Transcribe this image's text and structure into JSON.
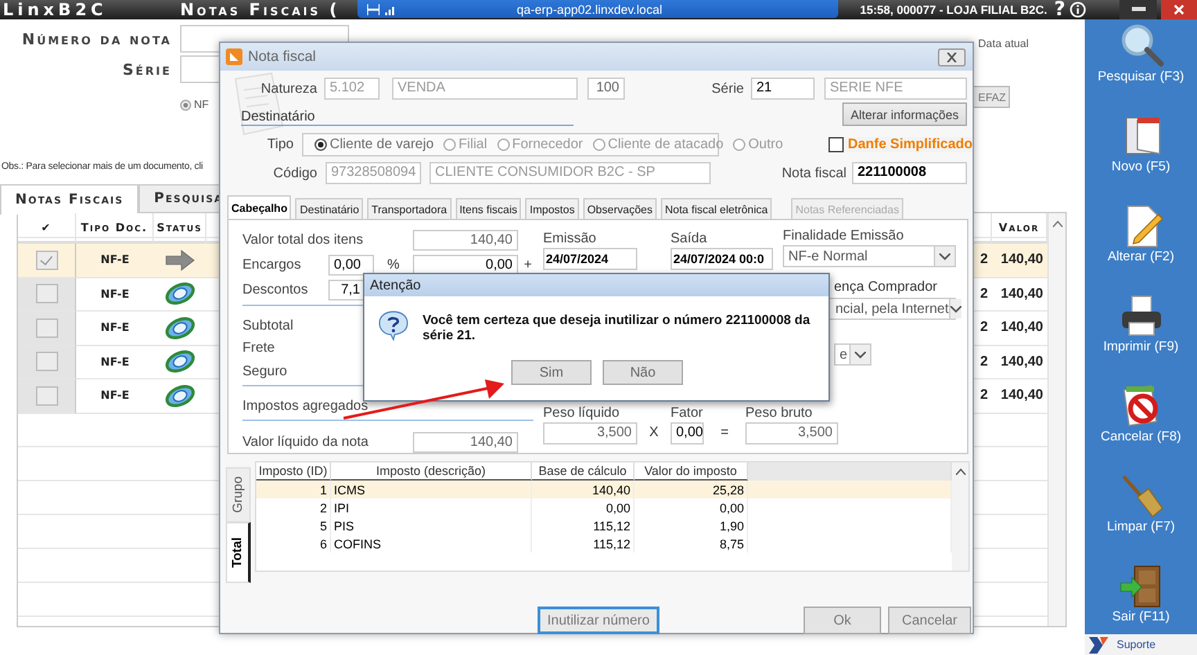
{
  "remote_bar": {
    "host": "qa-erp-app02.linxdev.local"
  },
  "app": {
    "logo": "LinxB2C",
    "title": "Notas Fiscais (",
    "session": "15:58, 000077 - LOJA FILIAL B2C.",
    "help": "?"
  },
  "search_form": {
    "numero_label": "Número da nota",
    "serie_label": "Série",
    "doc_type": {
      "label": "NF",
      "selected": true
    },
    "data_atual_label": "Data atual",
    "button": "EFAZ",
    "obs": "Obs.: Para selecionar mais de um documento, cli"
  },
  "tabs": [
    {
      "label": "Notas Fiscais",
      "selected": true
    },
    {
      "label": "Pesquisa",
      "selected": false
    }
  ],
  "grid": {
    "columns": [
      "✔",
      "Tipo Doc.",
      "Status",
      "Valor"
    ],
    "rows": [
      {
        "selected": true,
        "checked": true,
        "type": "NF-E",
        "kind": "arrow",
        "column_5": "2",
        "value": "140,40"
      },
      {
        "selected": false,
        "checked": false,
        "type": "NF-E",
        "kind": "globe",
        "column_5": "2",
        "value": "140,40"
      },
      {
        "selected": false,
        "checked": false,
        "type": "NF-E",
        "kind": "globe",
        "column_5": "2",
        "value": "140,40"
      },
      {
        "selected": false,
        "checked": false,
        "type": "NF-E",
        "kind": "globe",
        "column_5": "2",
        "value": "140,40"
      },
      {
        "selected": false,
        "checked": false,
        "type": "NF-E",
        "kind": "globe",
        "column_5": "2",
        "value": "140,40"
      }
    ]
  },
  "nf_dialog": {
    "title": "Nota fiscal",
    "natureza": {
      "label": "Natureza",
      "code": "5.102",
      "description": "VENDA",
      "number": "100"
    },
    "serie": {
      "label": "Série",
      "code": "21",
      "description": "SERIE NFE"
    },
    "section": "Destinatário",
    "alterar_button": "Alterar informações",
    "tipo": {
      "label": "Tipo",
      "options": [
        {
          "label": "Cliente de varejo",
          "selected": true
        },
        {
          "label": "Filial",
          "selected": false
        },
        {
          "label": "Fornecedor",
          "selected": false
        },
        {
          "label": "Cliente de atacado",
          "selected": false
        },
        {
          "label": "Outro",
          "selected": false
        }
      ]
    },
    "danfe": {
      "label": "Danfe Simplificado",
      "checked": false
    },
    "codigo": {
      "label": "Código",
      "code": "97328508094",
      "name": "CLIENTE CONSUMIDOR B2C - SP"
    },
    "nota_fiscal": {
      "label": "Nota fiscal",
      "value": "221100008"
    },
    "tabs": [
      {
        "label": "Cabeçalho",
        "selected": true,
        "disabled": false
      },
      {
        "label": "Destinatário",
        "selected": false,
        "disabled": false
      },
      {
        "label": "Transportadora",
        "selected": false,
        "disabled": false
      },
      {
        "label": "Itens fiscais",
        "selected": false,
        "disabled": false
      },
      {
        "label": "Impostos",
        "selected": false,
        "disabled": false
      },
      {
        "label": "Observações",
        "selected": false,
        "disabled": false
      },
      {
        "label": "Nota fiscal eletrônica",
        "selected": false,
        "disabled": false
      },
      {
        "label": "Notas Referenciadas",
        "selected": false,
        "disabled": true
      }
    ],
    "amounts": [
      {
        "label": "Valor total dos itens",
        "value": "140,40"
      },
      {
        "label": "Encargos",
        "percent": "0,00",
        "unit": "%",
        "value": "0,00",
        "operator": "+"
      },
      {
        "label": "Descontos",
        "percent": "7,1"
      },
      {
        "label": "Subtotal"
      },
      {
        "label": "Frete"
      },
      {
        "label": "Seguro"
      },
      {
        "label": "Impostos agregados"
      },
      {
        "label": "Valor líquido da nota",
        "value": "140,40"
      }
    ],
    "emissao": {
      "label": "Emissão",
      "value": "24/07/2024"
    },
    "saida": {
      "label": "Saída",
      "value": "24/07/2024 00:0"
    },
    "finalidade": {
      "label": "Finalidade Emissão",
      "value": "NF-e Normal"
    },
    "presenca": {
      "label": "ença Comprador",
      "value": "ncial, pela Internet"
    },
    "select_3": {
      "value": "e"
    },
    "peso_liquido": {
      "label": "Peso líquido",
      "value": "3,500"
    },
    "times": "X",
    "fator": {
      "label": "Fator",
      "value": "0,00"
    },
    "equals": "=",
    "peso_bruto": {
      "label": "Peso bruto",
      "value": "3,500"
    },
    "side_tabs": [
      {
        "label": "Grupo",
        "selected": false
      },
      {
        "label": "Total",
        "selected": true
      }
    ],
    "taxes": {
      "columns": [
        "Imposto (ID)",
        "Imposto (descrição)",
        "Base de cálculo",
        "Valor do imposto"
      ],
      "rows": [
        {
          "selected": true,
          "cells": [
            "1",
            "ICMS",
            "140,40",
            "25,28"
          ]
        },
        {
          "selected": false,
          "cells": [
            "2",
            "IPI",
            "0,00",
            "0,00"
          ]
        },
        {
          "selected": false,
          "cells": [
            "5",
            "PIS",
            "115,12",
            "1,90"
          ]
        },
        {
          "selected": false,
          "cells": [
            "6",
            "COFINS",
            "115,12",
            "8,75"
          ]
        }
      ]
    },
    "buttons": [
      {
        "label": "Inutilizar número",
        "focused": true
      },
      {
        "label": "Ok",
        "focused": false
      },
      {
        "label": "Cancelar",
        "focused": false
      }
    ]
  },
  "alert": {
    "title": "Atenção",
    "message": "Você tem certeza que deseja inutilizar o número 221100008 da série 21.",
    "buttons": [
      "Sim",
      "Não"
    ]
  },
  "toolbar": [
    {
      "label": "Pesquisar (F3)",
      "kind": "search"
    },
    {
      "label": "Novo (F5)",
      "kind": "new"
    },
    {
      "label": "Alterar (F2)",
      "kind": "edit"
    },
    {
      "label": "Imprimir (F9)",
      "kind": "print"
    },
    {
      "label": "Cancelar (F8)",
      "kind": "cancel"
    },
    {
      "label": "Limpar (F7)",
      "kind": "clear"
    },
    {
      "label": "Sair (F11)",
      "kind": "exit"
    }
  ],
  "support": "Suporte"
}
